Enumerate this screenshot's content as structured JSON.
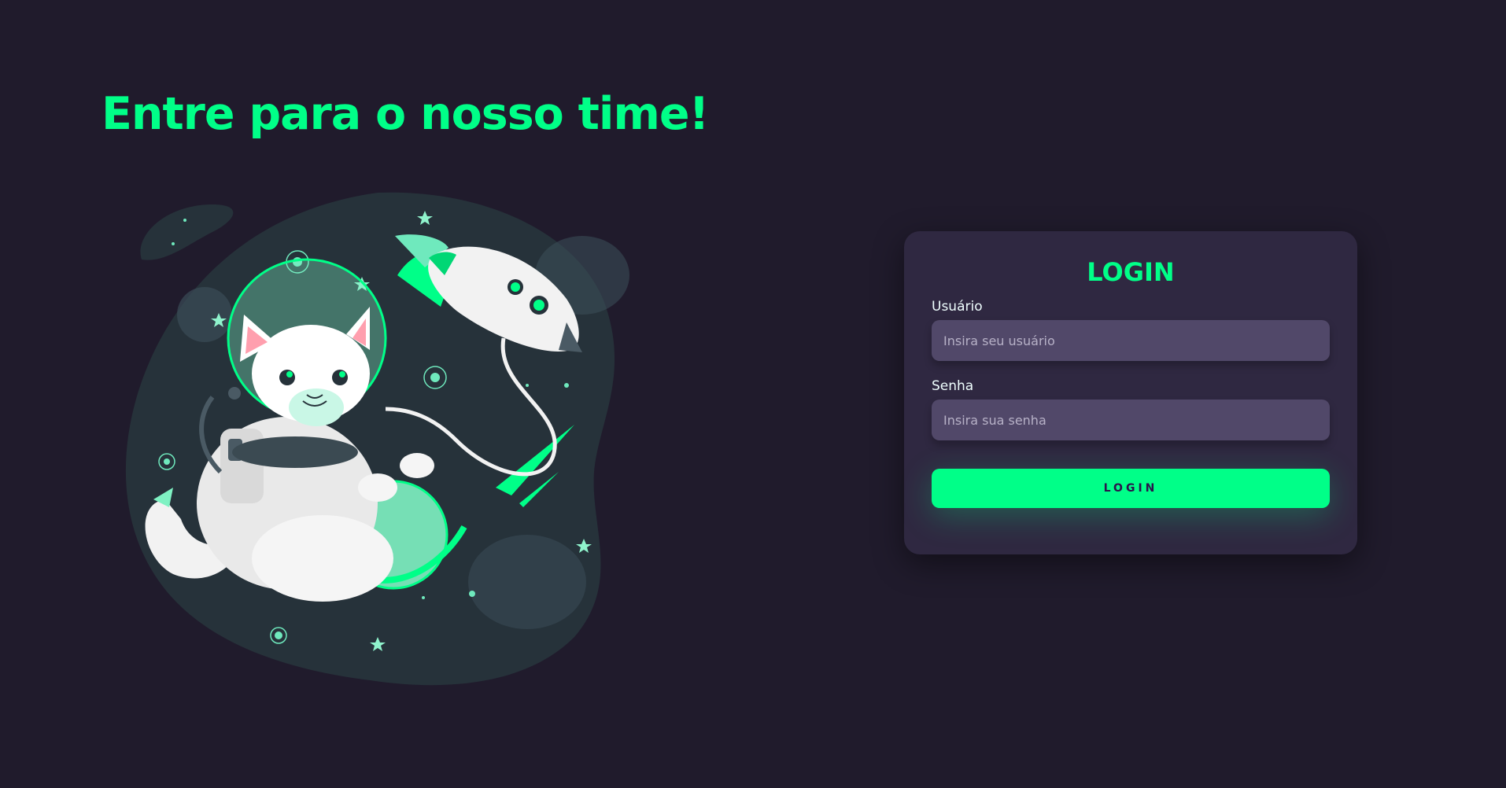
{
  "hero": {
    "title": "Entre para o nosso time!"
  },
  "illustration": {
    "icon": "astronaut-cat-rocket-illustration"
  },
  "login": {
    "title": "LOGIN",
    "username_label": "Usuário",
    "username_placeholder": "Insira seu usuário",
    "username_value": "",
    "password_label": "Senha",
    "password_placeholder": "Insira sua senha",
    "password_value": "",
    "button_label": "LOGIN"
  },
  "colors": {
    "background": "#201b2c",
    "accent": "#00ff88",
    "card": "#2f2841",
    "input": "#514869"
  }
}
